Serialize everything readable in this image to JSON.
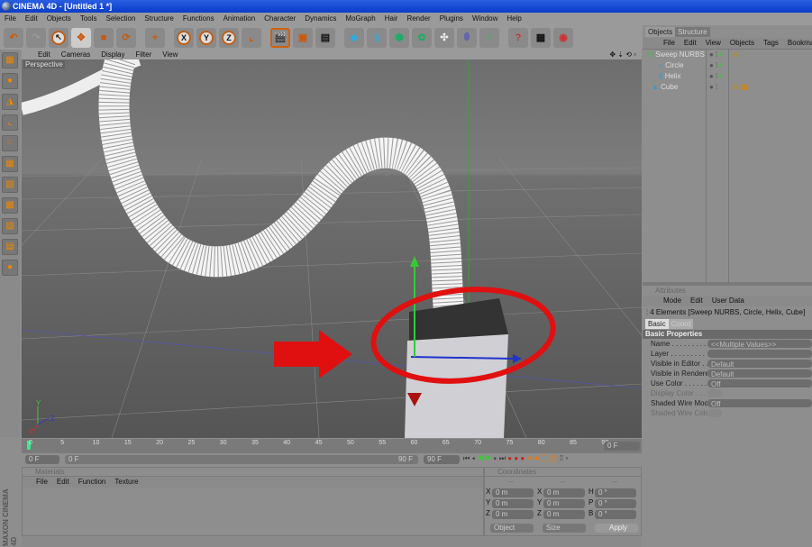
{
  "window": {
    "title": "CINEMA 4D - [Untitled 1 *]"
  },
  "menu": [
    "File",
    "Edit",
    "Objects",
    "Tools",
    "Selection",
    "Structure",
    "Functions",
    "Animation",
    "Character",
    "Dynamics",
    "MoGraph",
    "Hair",
    "Render",
    "Plugins",
    "Window",
    "Help"
  ],
  "toolbar": {
    "axis_labels": [
      "X",
      "Y",
      "Z"
    ]
  },
  "viewport": {
    "menu": [
      "Edit",
      "Cameras",
      "Display",
      "Filter",
      "View"
    ],
    "camera_label": "Perspective",
    "axis_labels": [
      "Y",
      "Z",
      "X"
    ]
  },
  "objects_panel": {
    "tabs": [
      "Objects",
      "Structure"
    ],
    "menu": [
      "File",
      "Edit",
      "View",
      "Objects",
      "Tags",
      "Bookmarks"
    ],
    "items": [
      {
        "name": "Sweep NURBS",
        "level": 0
      },
      {
        "name": "Circle",
        "level": 1
      },
      {
        "name": "Helix",
        "level": 1
      },
      {
        "name": "Cube",
        "level": 0
      }
    ]
  },
  "attributes": {
    "header": "Attributes",
    "menu": [
      "Mode",
      "Edit",
      "User Data"
    ],
    "summary": "4 Elements [Sweep NURBS, Circle, Helix, Cube]",
    "tabs": [
      "Basic",
      "Coord"
    ],
    "section": "Basic Properties",
    "rows": [
      {
        "label": "Name . . . . . . . . . . . .",
        "value": "<<Multiple Values>>"
      },
      {
        "label": "Layer . . . . . . . . . . . .",
        "value": ""
      },
      {
        "label": "Visible in Editor . . . . .",
        "value": "Default"
      },
      {
        "label": "Visible in Renderer . .",
        "value": "Default"
      },
      {
        "label": "Use Color . . . . . . . . .",
        "value": "Off"
      },
      {
        "label": "Display Color . . . . .",
        "value": ""
      },
      {
        "label": "Shaded Wire Mode",
        "value": "Off"
      },
      {
        "label": "Shaded Wire Color",
        "value": ""
      }
    ]
  },
  "timeline": {
    "ticks": [
      "0",
      "5",
      "10",
      "15",
      "20",
      "25",
      "30",
      "35",
      "40",
      "45",
      "50",
      "55",
      "60",
      "65",
      "70",
      "75",
      "80",
      "85",
      "90"
    ],
    "current_frame": "0 F",
    "start": "0 F",
    "slider_start": "0 F",
    "slider_end": "90 F",
    "end": "90 F"
  },
  "materials": {
    "header": "Materials",
    "menu": [
      "File",
      "Edit",
      "Function",
      "Texture"
    ]
  },
  "coordinates": {
    "header": "Coordinates",
    "dashes": [
      "--",
      "--",
      "--"
    ],
    "rows": [
      {
        "a": "X",
        "av": "0 m",
        "b": "X",
        "bv": "0 m",
        "c": "H",
        "cv": "0 °"
      },
      {
        "a": "Y",
        "av": "0 m",
        "b": "Y",
        "bv": "0 m",
        "c": "P",
        "cv": "0 °"
      },
      {
        "a": "Z",
        "av": "0 m",
        "b": "Z",
        "bv": "0 m",
        "c": "B",
        "cv": "0 °"
      }
    ],
    "mode": "Object",
    "size": "Size",
    "apply": "Apply"
  },
  "branding": "MAXON CINEMA 4D",
  "colors": {
    "annotation": "#e01010",
    "title_bar": "#0a3cc8"
  }
}
